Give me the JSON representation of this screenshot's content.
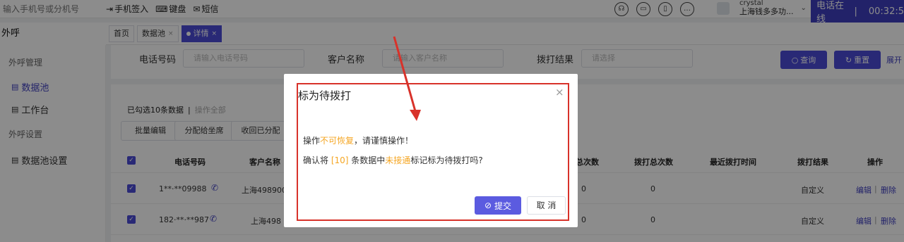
{
  "topbar": {
    "search_placeholder": "输入手机号或分机号",
    "phone_signin": "手机签入",
    "keyboard": "键盘",
    "sms": "短信",
    "user_name": "crystal",
    "user_company": "上海钱多多功...",
    "status": "电话在线",
    "status_sep": "|",
    "timer": "00:32:5"
  },
  "sidebar": {
    "title": "外呼",
    "group1": "外呼管理",
    "item_datapool": "数据池",
    "item_workbench": "工作台",
    "group2": "外呼设置",
    "item_datapool_settings": "数据池设置"
  },
  "tabs": [
    {
      "label": "首页"
    },
    {
      "label": "数据池"
    },
    {
      "label": "详情"
    }
  ],
  "filters": {
    "phone_label": "电话号码",
    "phone_placeholder": "请输入电话号码",
    "customer_label": "客户名称",
    "customer_placeholder": "请输入客户名称",
    "result_label": "拨打结果",
    "result_placeholder": "请选择",
    "query": "查询",
    "reset": "重置",
    "expand": "展开"
  },
  "table": {
    "selected_info": "已勾选10条数据",
    "sep": "|",
    "select_all": "操作全部",
    "ops": [
      "批量编辑",
      "分配给坐席",
      "收回已分配"
    ],
    "headers": {
      "phone": "电话号码",
      "customer": "客户名称",
      "connected_total": "接通总次数",
      "dial_total": "拨打总次数",
      "last_dial": "最近拨打时间",
      "result": "拨打结果",
      "action": "操作"
    },
    "rows": [
      {
        "phone": "1**·**09988",
        "customer": "上海498900",
        "connected": "0",
        "dials": "0",
        "result": "自定义",
        "edit": "编辑",
        "sep": "|",
        "delete": "删除"
      },
      {
        "phone": "182·**·**987",
        "customer": "上海498",
        "connected": "0",
        "dials": "0",
        "result": "自定义",
        "edit": "编辑",
        "sep": "|",
        "delete": "删除"
      }
    ]
  },
  "modal": {
    "title": "标为待拨打",
    "close": "×",
    "warn_prefix": "操作",
    "warn_highlight": "不可恢复",
    "warn_suffix": "，请谨慎操作！",
    "confirm_prefix": "确认将 ",
    "confirm_count": "[10]",
    "confirm_mid": " 条数据中",
    "confirm_highlight": "未接通",
    "confirm_suffix": "标记标为待拨打吗?",
    "submit": "提交",
    "cancel": "取 消"
  },
  "colors": {
    "accent": "#4b4bd8",
    "highlight": "#f5a623",
    "annotation": "#d8322a"
  }
}
